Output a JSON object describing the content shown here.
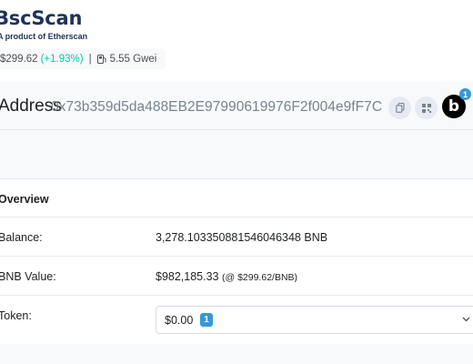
{
  "header": {
    "logo_title": "BscScan",
    "logo_sub": "A product of Etherscan",
    "bnb_price": "$299.62",
    "bnb_change": "(+1.93%)",
    "separator": "|",
    "gas_price": "5.55 Gwei"
  },
  "address": {
    "label": "Address",
    "value": "0x73b359d5da488EB2E97990619976F2f004e9fF7C",
    "badge_letter": "b",
    "badge_count": "1"
  },
  "overview": {
    "title": "Overview",
    "balance_label": "Balance:",
    "balance_value": "3,278.103350881546046348 BNB",
    "value_label": "BNB Value:",
    "value_amount": "$982,185.33",
    "value_rate": "(@ $299.62/BNB)",
    "token_label": "Token:",
    "token_value": "$0.00",
    "token_count": "1"
  },
  "icons": [
    "gas-pump-icon",
    "copy-icon",
    "qr-code-icon",
    "chevron-down-icon"
  ],
  "colors": {
    "brand": "#21325b",
    "positive": "#00c9a7",
    "badge_blue": "#3498db",
    "muted": "#77838f"
  }
}
